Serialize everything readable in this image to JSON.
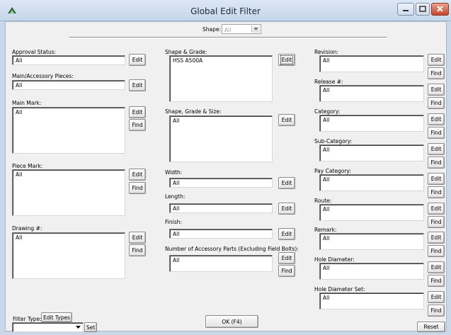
{
  "window": {
    "title": "Global Edit Filter"
  },
  "shape": {
    "label": "Shape:",
    "value": "All"
  },
  "left": {
    "approval_status": {
      "label": "Approval Status:",
      "value": "All"
    },
    "main_accessory": {
      "label": "Main/Accessory Pieces:",
      "value": "All"
    },
    "main_mark": {
      "label": "Main Mark:",
      "value": "All"
    },
    "piece_mark": {
      "label": "Piece Mark:",
      "value": "All"
    },
    "drawing": {
      "label": "Drawing #:",
      "value": "All"
    }
  },
  "middle": {
    "shape_grade": {
      "label": "Shape & Grade:",
      "value": "HSS A500A"
    },
    "shape_grade_size": {
      "label": "Shape, Grade & Size:",
      "value": "All"
    },
    "width": {
      "label": "Width:",
      "value": "All"
    },
    "length": {
      "label": "Length:",
      "value": "All"
    },
    "finish": {
      "label": "Finish:",
      "value": "All"
    },
    "accessory_parts": {
      "label": "Number of Accessory Parts (Excluding Field Bolts):",
      "value": "All"
    }
  },
  "right": {
    "revision": {
      "label": "Revision:",
      "value": "All"
    },
    "release": {
      "label": "Release #:",
      "value": "All"
    },
    "category": {
      "label": "Category:",
      "value": "All"
    },
    "sub_category": {
      "label": "Sub-Category:",
      "value": "All"
    },
    "pay_category": {
      "label": "Pay Category:",
      "value": "All"
    },
    "route": {
      "label": "Route:",
      "value": "All"
    },
    "remark": {
      "label": "Remark:",
      "value": "All"
    },
    "hole_diameter": {
      "label": "Hole Diameter:",
      "value": "All"
    },
    "hole_diameter_set": {
      "label": "Hole Diameter Set:",
      "value": "All"
    }
  },
  "buttons": {
    "edit": "Edit",
    "find": "Find",
    "ok": "OK (F4)",
    "reset": "Reset",
    "set": "Set",
    "edit_types": "Edit Types"
  },
  "filter_type": {
    "label": "Filter Type:",
    "value": ""
  },
  "colors": {
    "title_bg": "#c6d6ea",
    "client_bg": "#f0f0f0",
    "close_button": "#c6432a"
  },
  "icons": [
    "app-logo-icon",
    "minimize-icon",
    "maximize-icon",
    "close-icon",
    "dropdown-arrow-icon"
  ]
}
